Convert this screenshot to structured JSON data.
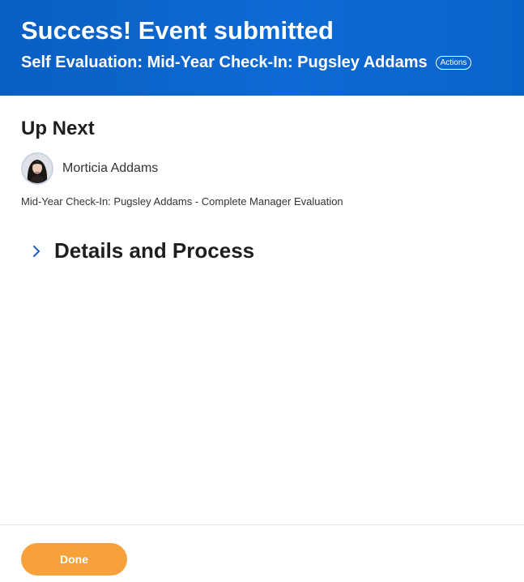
{
  "header": {
    "title": "Success! Event submitted",
    "subtitle": "Self Evaluation: Mid-Year Check-In: Pugsley Addams",
    "actions_label": "Actions",
    "background_color": "#0a63c9"
  },
  "up_next": {
    "heading": "Up Next",
    "person_name": "Morticia Addams",
    "task": "Mid-Year Check-In: Pugsley Addams - Complete Manager Evaluation"
  },
  "details": {
    "label": "Details and Process",
    "icon": "chevron-right-icon",
    "expanded": false
  },
  "footer": {
    "done_label": "Done",
    "done_color": "#f7a13a"
  }
}
